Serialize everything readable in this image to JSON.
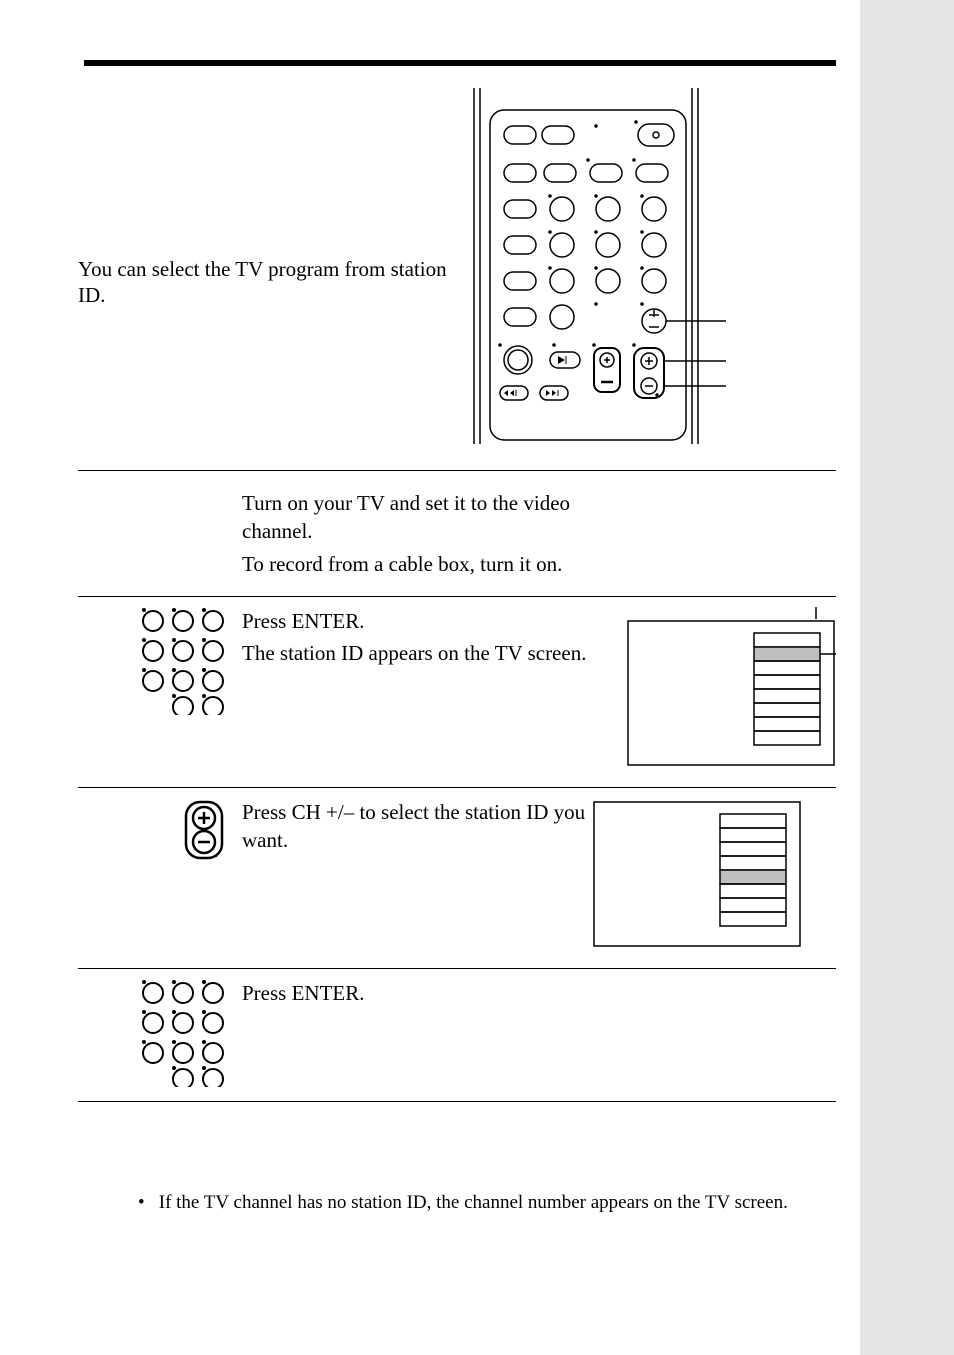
{
  "intro": "You can select the TV program from station ID.",
  "steps": [
    {
      "lines": [
        "Turn on your TV and set it to the video channel.",
        "To record from a cable box, turn it on."
      ],
      "icon": null,
      "tv": null
    },
    {
      "lines": [
        "Press ENTER.",
        "The station ID appears on the TV screen."
      ],
      "icon": "numpad",
      "tv": {
        "highlight_row": 1
      }
    },
    {
      "lines": [
        "Press CH +/– to select the station ID you want."
      ],
      "icon": "chplusminus",
      "tv": {
        "highlight_row": 4
      }
    },
    {
      "lines": [
        "Press ENTER."
      ],
      "icon": "numpad",
      "tv": null
    }
  ],
  "note_bullet": "•",
  "note": "If the TV channel has no station ID, the channel number appears on the TV screen."
}
